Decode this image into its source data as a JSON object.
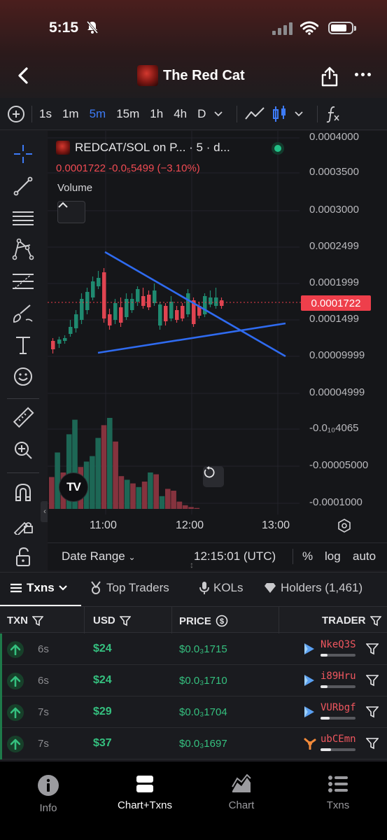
{
  "status": {
    "time": "5:15"
  },
  "header": {
    "title": "The Red Cat"
  },
  "toolbar": {
    "timeframes": [
      "1s",
      "1m",
      "5m",
      "15m",
      "1h",
      "4h",
      "D"
    ],
    "active": "5m",
    "fx_icon": "function-icon"
  },
  "chart": {
    "symbol": "REDCAT/SOL on P... · 5 · d...",
    "ohlc": "0.0001722  -0.0₅5499 (−3.10%)",
    "volume_label": "Volume",
    "last_price": "0.0001722",
    "price_ticks": [
      "0.0004000",
      "0.0003500",
      "0.0003000",
      "0.0002499",
      "0.0001999",
      "0.0001499",
      "0.00009999",
      "0.00004999",
      "-0.0₁₀4065",
      "-0.00005000",
      "-0.0001000"
    ],
    "time_ticks": [
      "11:00",
      "12:00",
      "13:00"
    ],
    "date_range": "Date Range",
    "utc_time": "12:15:01 (UTC)",
    "pct": "%",
    "log": "log",
    "auto": "auto",
    "tv_logo": "TV",
    "colors": {
      "up": "#1f8a70",
      "down": "#e04451",
      "trend": "#2f6bf0"
    }
  },
  "chart_data": {
    "type": "candlestick",
    "candles_up_down": [
      "down",
      "up",
      "up",
      "up",
      "up",
      "up",
      "up",
      "up",
      "up",
      "down",
      "down",
      "up",
      "down",
      "up",
      "up",
      "up",
      "down",
      "down",
      "up",
      "up",
      "down",
      "up",
      "down",
      "down",
      "up",
      "down",
      "down",
      "up",
      "up",
      "up",
      "down"
    ],
    "price_range": [
      -0.0001,
      0.0004
    ],
    "last_price": 0.0001722,
    "volume": [
      0.35,
      0.62,
      0.4,
      0.82,
      0.98,
      0.46,
      0.52,
      0.58,
      0.78,
      0.92,
      1.0,
      0.74,
      0.36,
      0.32,
      0.28,
      0.24,
      0.3,
      0.4,
      0.38,
      0.14,
      0.22,
      0.2,
      0.08,
      0.04,
      0.02,
      0.01
    ],
    "volume_up": [
      false,
      true,
      false,
      true,
      true,
      false,
      true,
      true,
      true,
      false,
      true,
      false,
      false,
      true,
      false,
      true,
      false,
      true,
      false,
      true,
      false,
      false,
      false,
      false,
      false,
      false
    ]
  },
  "tabs": [
    {
      "label": "Txns",
      "active": true
    },
    {
      "label": "Top Traders"
    },
    {
      "label": "KOLs"
    },
    {
      "label": "Holders (1,461)"
    }
  ],
  "table": {
    "headers": [
      "TXN",
      "USD",
      "PRICE",
      "TRADER"
    ],
    "rows": [
      {
        "age": "6s",
        "usd": "$24",
        "price": "$0.0₃1715",
        "trader": "NkeQ3S",
        "bar": 0.2
      },
      {
        "age": "6s",
        "usd": "$24",
        "price": "$0.0₃1710",
        "trader": "i89Hru",
        "bar": 0.2
      },
      {
        "age": "7s",
        "usd": "$29",
        "price": "$0.0₃1704",
        "trader": "VURbgf",
        "bar": 0.25
      },
      {
        "age": "7s",
        "usd": "$37",
        "price": "$0.0₃1697",
        "trader": "ubCEmn",
        "bar": 0.3
      }
    ]
  },
  "bottom_nav": [
    {
      "label": "Info",
      "icon": "info-icon"
    },
    {
      "label": "Chart+Txns",
      "icon": "chart-txns-icon",
      "active": true
    },
    {
      "label": "Chart",
      "icon": "area-chart-icon"
    },
    {
      "label": "Txns",
      "icon": "list-icon"
    }
  ]
}
